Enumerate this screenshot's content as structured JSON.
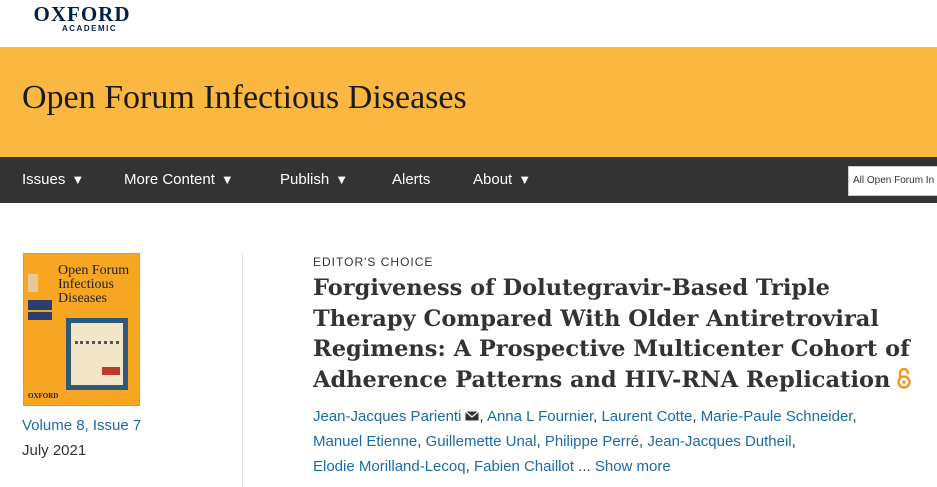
{
  "brand": {
    "publisher": "OXFORD",
    "sub": "ACADEMIC"
  },
  "journal": {
    "title": "Open Forum Infectious Diseases"
  },
  "nav": {
    "items": [
      {
        "label": "Issues",
        "dropdown": true
      },
      {
        "label": "More Content",
        "dropdown": true
      },
      {
        "label": "Publish",
        "dropdown": true
      },
      {
        "label": "Alerts",
        "dropdown": false
      },
      {
        "label": "About",
        "dropdown": true
      }
    ],
    "caret": "▼",
    "search_scope": "All Open Forum In"
  },
  "issue": {
    "cover": {
      "title": "Open Forum Infectious Diseases",
      "footer": "OXFORD"
    },
    "volume_link": "Volume 8, Issue 7",
    "date": "July 2021"
  },
  "article": {
    "eyebrow": "EDITOR'S CHOICE",
    "title": "Forgiveness of Dolutegravir-Based Triple Therapy Compared With Older Antiretroviral Regimens: A Prospective Multicenter Cohort of Adherence Patterns and HIV-RNA Replication",
    "open_access_icon": "open-access-lock-icon",
    "authors": [
      "Jean-Jacques Parienti",
      "Anna L Fournier",
      "Laurent Cotte",
      "Marie-Paule Schneider",
      "Manuel Etienne",
      "Guillemette Unal",
      "Philippe Perré",
      "Jean-Jacques Dutheil",
      "Elodie Morilland-Lecoq",
      "Fabien Chaillot"
    ],
    "ellipsis": "...",
    "show_more": "Show more"
  },
  "colors": {
    "banner": "#fbb840",
    "nav": "#333333",
    "link": "#1a6aa8",
    "open_access": "#f7941d"
  }
}
